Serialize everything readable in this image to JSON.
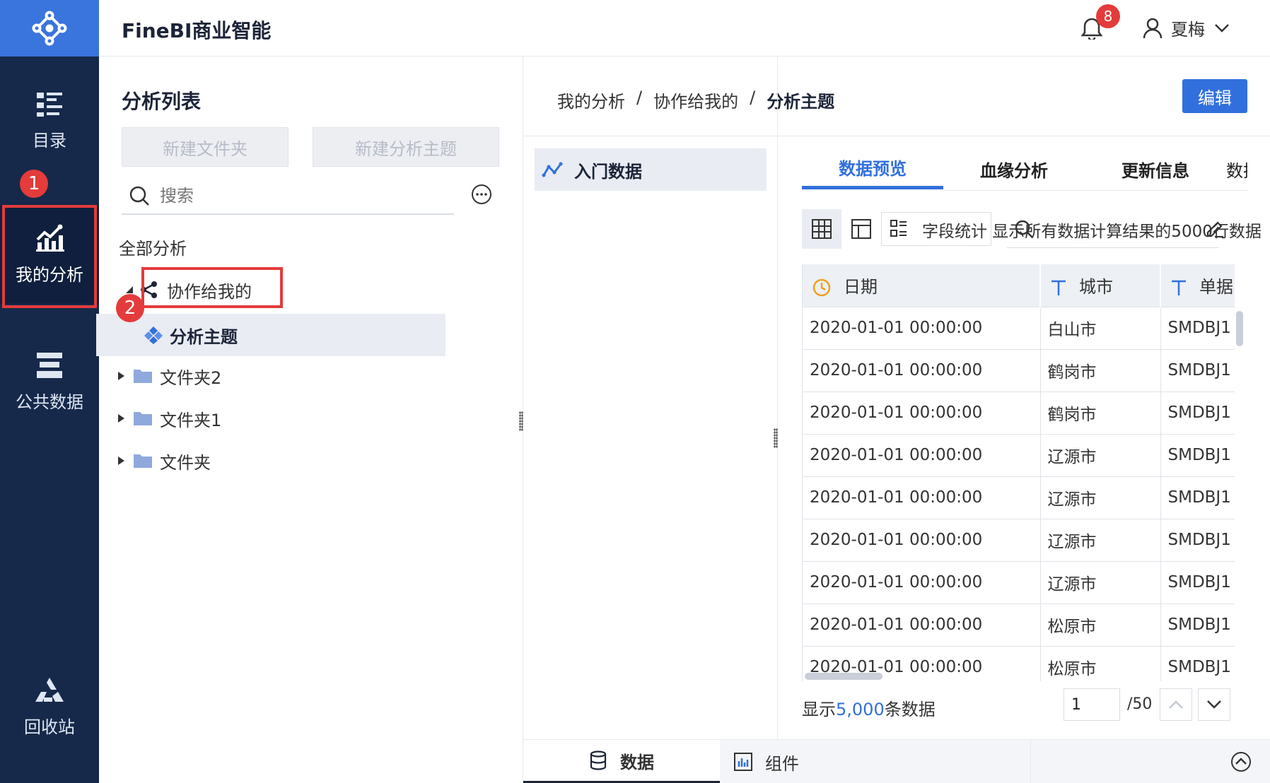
{
  "header": {
    "app_title": "FineBI商业智能",
    "notification_count": "8",
    "user_name": "夏梅"
  },
  "leftnav": {
    "items": [
      {
        "label": "目录"
      },
      {
        "label": "我的分析"
      },
      {
        "label": "公共数据"
      },
      {
        "label": "回收站"
      }
    ],
    "step_badge": "1"
  },
  "list_panel": {
    "title": "分析列表",
    "new_folder_label": "新建文件夹",
    "new_subject_label": "新建分析主题",
    "search_placeholder": "搜索",
    "all_label": "全部分析",
    "step_badge": "2",
    "tree": [
      {
        "label": "协作给我的"
      },
      {
        "label": "分析主题"
      },
      {
        "label": "文件夹2"
      },
      {
        "label": "文件夹1"
      },
      {
        "label": "文件夹"
      }
    ]
  },
  "main": {
    "breadcrumb": [
      "我的分析",
      "/",
      "协作给我的",
      "/",
      "分析主题"
    ],
    "edit_label": "编辑",
    "dataset_name": "入门数据",
    "tabs": [
      {
        "label": "数据预览"
      },
      {
        "label": "血缘分析"
      },
      {
        "label": "更新信息"
      },
      {
        "label": "数据状"
      }
    ],
    "toolbar_text": "字段统计 显示所有数据计算结果的5000行数据",
    "table": {
      "columns": [
        {
          "label": "日期",
          "type_icon": "clock-icon"
        },
        {
          "label": "城市",
          "type_icon": "text-type-icon"
        },
        {
          "label": "单据",
          "type_icon": "text-type-icon"
        }
      ],
      "rows": [
        [
          "2020-01-01 00:00:00",
          "白山市",
          "SMDBJ1"
        ],
        [
          "2020-01-01 00:00:00",
          "鹤岗市",
          "SMDBJ1"
        ],
        [
          "2020-01-01 00:00:00",
          "鹤岗市",
          "SMDBJ1"
        ],
        [
          "2020-01-01 00:00:00",
          "辽源市",
          "SMDBJ1"
        ],
        [
          "2020-01-01 00:00:00",
          "辽源市",
          "SMDBJ1"
        ],
        [
          "2020-01-01 00:00:00",
          "辽源市",
          "SMDBJ1"
        ],
        [
          "2020-01-01 00:00:00",
          "辽源市",
          "SMDBJ1"
        ],
        [
          "2020-01-01 00:00:00",
          "松原市",
          "SMDBJ1"
        ],
        [
          "2020-01-01 00:00:00",
          "松原市",
          "SMDBJ1"
        ]
      ]
    },
    "pager": {
      "prefix": "显示",
      "count": "5,000",
      "suffix": "条数据",
      "page": "1",
      "total": "/50"
    }
  },
  "bottom_tabs": [
    {
      "label": "数据"
    },
    {
      "label": "组件"
    }
  ],
  "colors": {
    "nav_bg": "#16294b",
    "logo_bg": "#3a74dd",
    "accent": "#3170dc",
    "highlight_red": "#e43b3b",
    "date_icon": "#f0a020"
  }
}
